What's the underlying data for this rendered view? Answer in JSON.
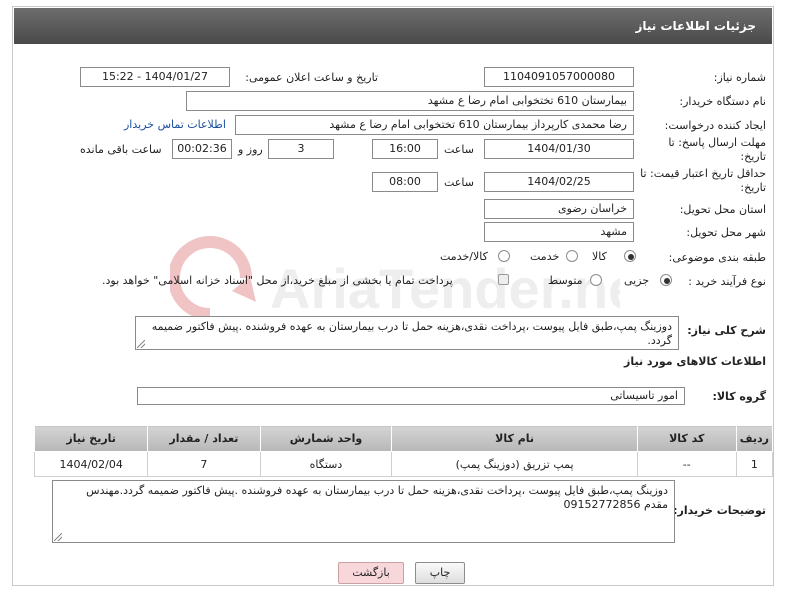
{
  "header": {
    "title": "جزئیات اطلاعات نیاز"
  },
  "form": {
    "need_number_label": "شماره نیاز:",
    "need_number": "1104091057000080",
    "announce_label": "تاریخ و ساعت اعلان عمومی:",
    "announce_value": "1404/01/27 - 15:22",
    "buyer_org_label": "نام دستگاه خریدار:",
    "buyer_org": "بیمارستان 610 تختخوابی امام رضا ع  مشهد",
    "requester_label": "ایجاد کننده درخواست:",
    "requester": "رضا محمدی کارپرداز بیمارستان 610 تختخوابی امام رضا ع  مشهد",
    "contact_link": "اطلاعات تماس خریدار",
    "deadline_label": "مهلت ارسال پاسخ: تا تاریخ:",
    "deadline_date": "1404/01/30",
    "time_label": "ساعت",
    "deadline_time": "16:00",
    "days_value": "3",
    "days_label": "روز و",
    "remaining_time": "00:02:36",
    "remaining_label": "ساعت باقی مانده",
    "price_validity_label": "حداقل تاریخ اعتبار قیمت: تا تاریخ:",
    "price_validity_date": "1404/02/25",
    "price_validity_time": "08:00",
    "province_label": "استان محل تحویل:",
    "province": "خراسان رضوی",
    "city_label": "شهر محل تحویل:",
    "city": "مشهد",
    "category_label": "طبقه بندی موضوعی:",
    "category_options": [
      "کالا",
      "خدمت",
      "کالا/خدمت"
    ],
    "category_selected": "کالا",
    "process_label": "نوع فرآیند خرید :",
    "process_options": [
      "جزیی",
      "متوسط"
    ],
    "process_selected": "جزیی",
    "payment_note": "پرداخت تمام یا بخشی از مبلغ خرید،از محل \"اسناد خزانه اسلامی\" خواهد بود.",
    "description_label": "شرح کلی نیاز:",
    "description": "دوزینگ پمپ،طبق فایل پیوست ،پرداخت نقدی،هزینه حمل تا درب بیمارستان به عهده فروشنده .پیش فاکتور ضمیمه گردد."
  },
  "goods": {
    "section_title": "اطلاعات کالاهای مورد نیاز",
    "group_label": "گروه کالا:",
    "group_value": "امور تاسیساتی",
    "columns": [
      "ردیف",
      "کد کالا",
      "نام کالا",
      "واحد شمارش",
      "تعداد / مقدار",
      "تاریخ نیاز"
    ],
    "rows": [
      [
        "1",
        "--",
        "پمپ تزریق (دوزینگ پمپ)",
        "دستگاه",
        "7",
        "1404/02/04"
      ]
    ]
  },
  "buyer_notes": {
    "label": "توضیحات خریدار:",
    "text": "دوزینگ پمپ،طبق فایل پیوست ،پرداخت نقدی،هزینه حمل تا درب بیمارستان به عهده فروشنده .پیش فاکتور ضمیمه گردد.مهندس مقدم 09152772856"
  },
  "buttons": {
    "print": "چاپ",
    "back": "بازگشت"
  },
  "watermark": {
    "text": "AriaTender.net"
  },
  "colors": {
    "header_bg": "#5a5a5a",
    "link": "#1a4fa0",
    "back_button": "#f8d7da"
  }
}
